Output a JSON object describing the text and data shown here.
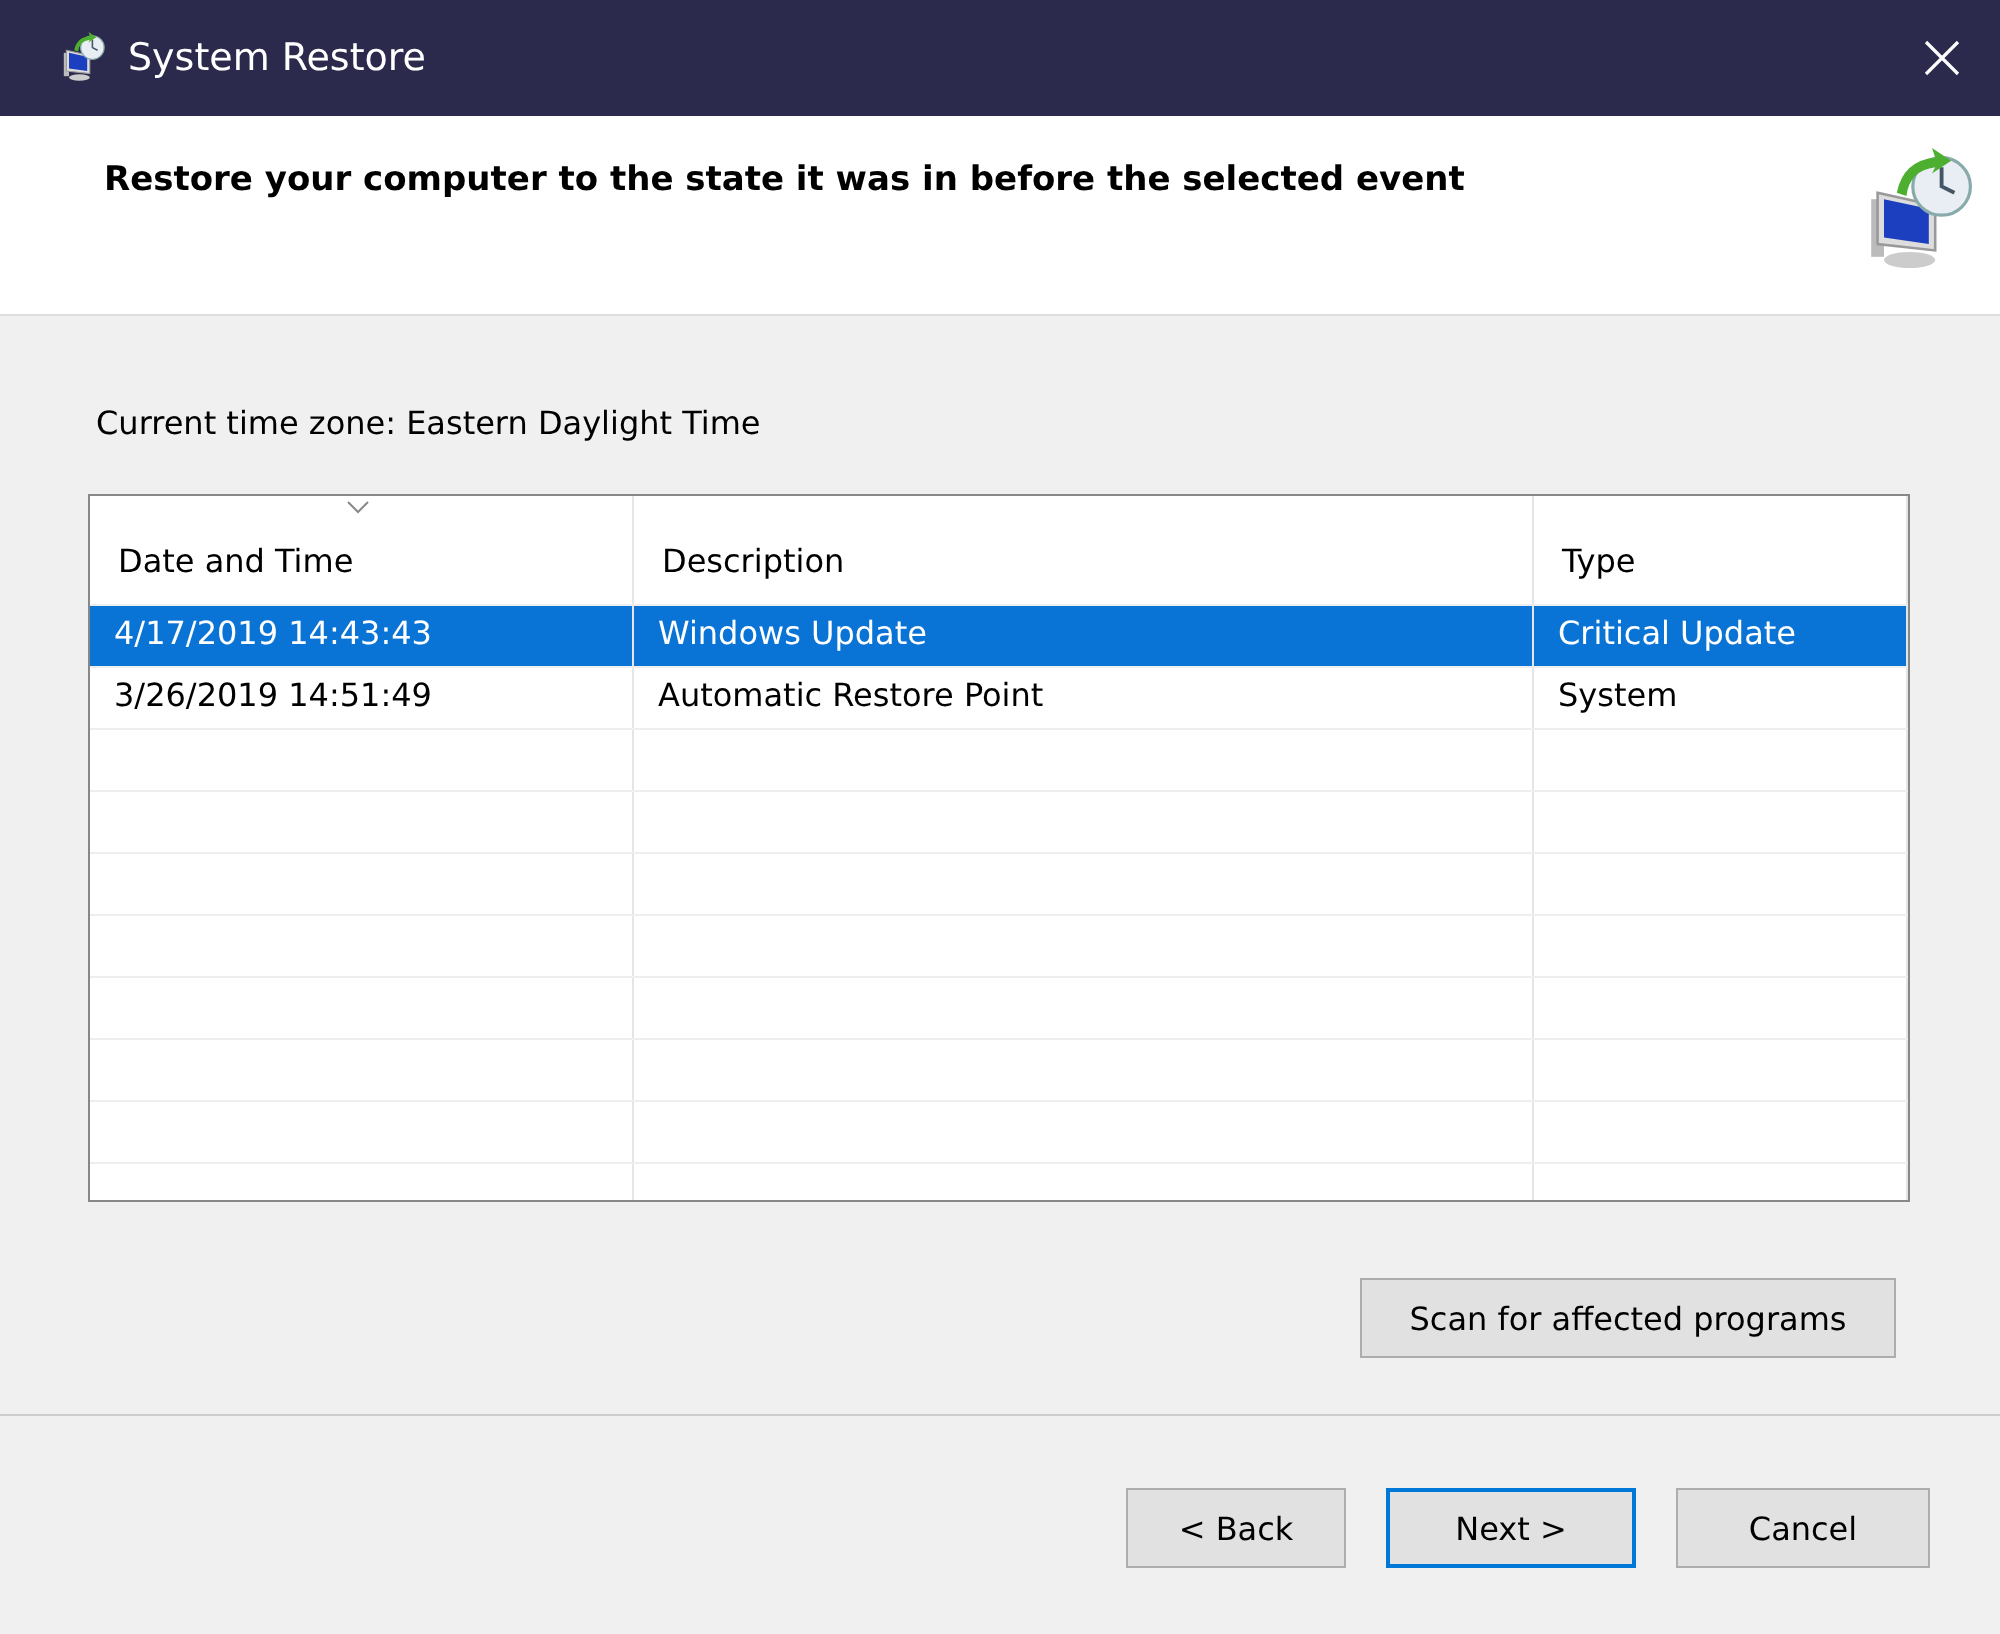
{
  "window": {
    "title": "System Restore"
  },
  "header": {
    "heading": "Restore your computer to the state it was in before the selected event"
  },
  "time_zone": "Current time zone: Eastern Daylight Time",
  "table": {
    "columns": [
      {
        "label": "Date and Time",
        "sorted": true
      },
      {
        "label": "Description",
        "sorted": false
      },
      {
        "label": "Type",
        "sorted": false
      }
    ],
    "rows": [
      {
        "cells": [
          "4/17/2019 14:43:43",
          "Windows Update",
          "Critical Update"
        ],
        "selected": true
      },
      {
        "cells": [
          "3/26/2019 14:51:49",
          "Automatic Restore Point",
          "System"
        ],
        "selected": false
      }
    ]
  },
  "scan_button": "Scan for affected programs",
  "buttons": [
    {
      "label": "< Back",
      "focused": false
    },
    {
      "label": "Next >",
      "focused": true
    },
    {
      "label": "Cancel",
      "focused": false
    }
  ]
}
